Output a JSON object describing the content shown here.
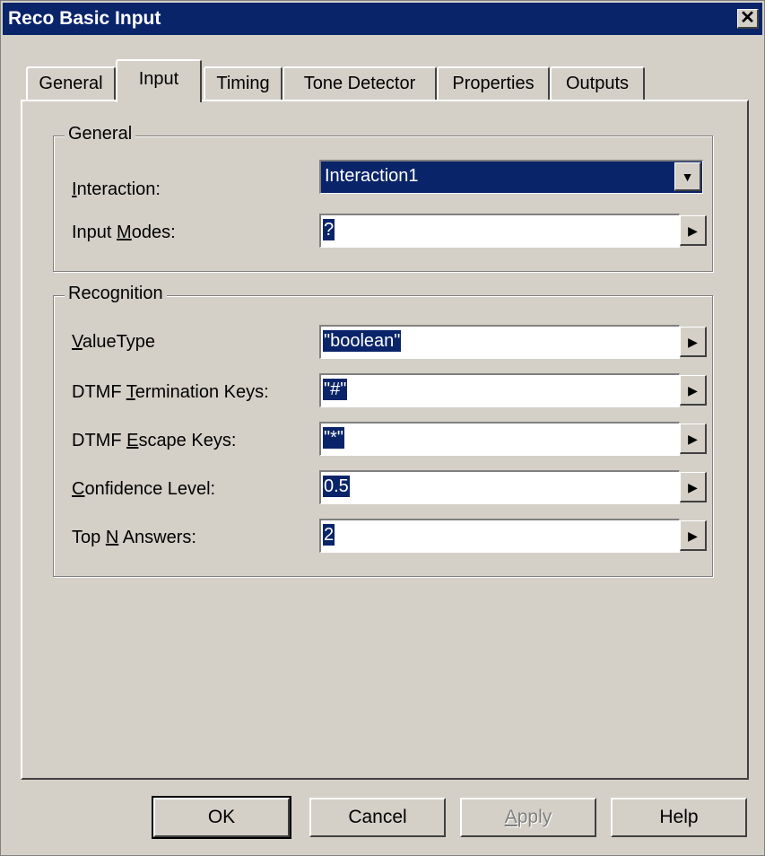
{
  "window": {
    "title": "Reco Basic Input",
    "close_glyph": "✕"
  },
  "tabs": [
    {
      "label": "General"
    },
    {
      "label": "Input",
      "active": true
    },
    {
      "label": "Timing"
    },
    {
      "label": "Tone Detector"
    },
    {
      "label": "Properties"
    },
    {
      "label": "Outputs"
    }
  ],
  "general_group": {
    "caption": "General",
    "interaction": {
      "label_pre": "",
      "label_key": "I",
      "label_post": "nteraction:",
      "value": "Interaction1"
    },
    "input_modes": {
      "label_pre": "Input ",
      "label_key": "M",
      "label_post": "odes:",
      "value": "?"
    }
  },
  "recognition_group": {
    "caption": "Recognition",
    "fields": [
      {
        "label_pre": "",
        "label_key": "V",
        "label_post": "alueType",
        "value": "\"boolean\""
      },
      {
        "label_pre": "DTMF ",
        "label_key": "T",
        "label_post": "ermination Keys:",
        "value": "\"#\""
      },
      {
        "label_pre": "DTMF ",
        "label_key": "E",
        "label_post": "scape Keys:",
        "value": "\"*\""
      },
      {
        "label_pre": "",
        "label_key": "C",
        "label_post": "onfidence Level:",
        "value": "0.5"
      },
      {
        "label_pre": "Top ",
        "label_key": "N",
        "label_post": " Answers:",
        "value": "2"
      }
    ]
  },
  "buttons": {
    "ok": "OK",
    "cancel": "Cancel",
    "apply_key": "A",
    "apply_rest": "pply",
    "help": "Help"
  },
  "icons": {
    "dropdown": "▼",
    "expand": "▶"
  }
}
